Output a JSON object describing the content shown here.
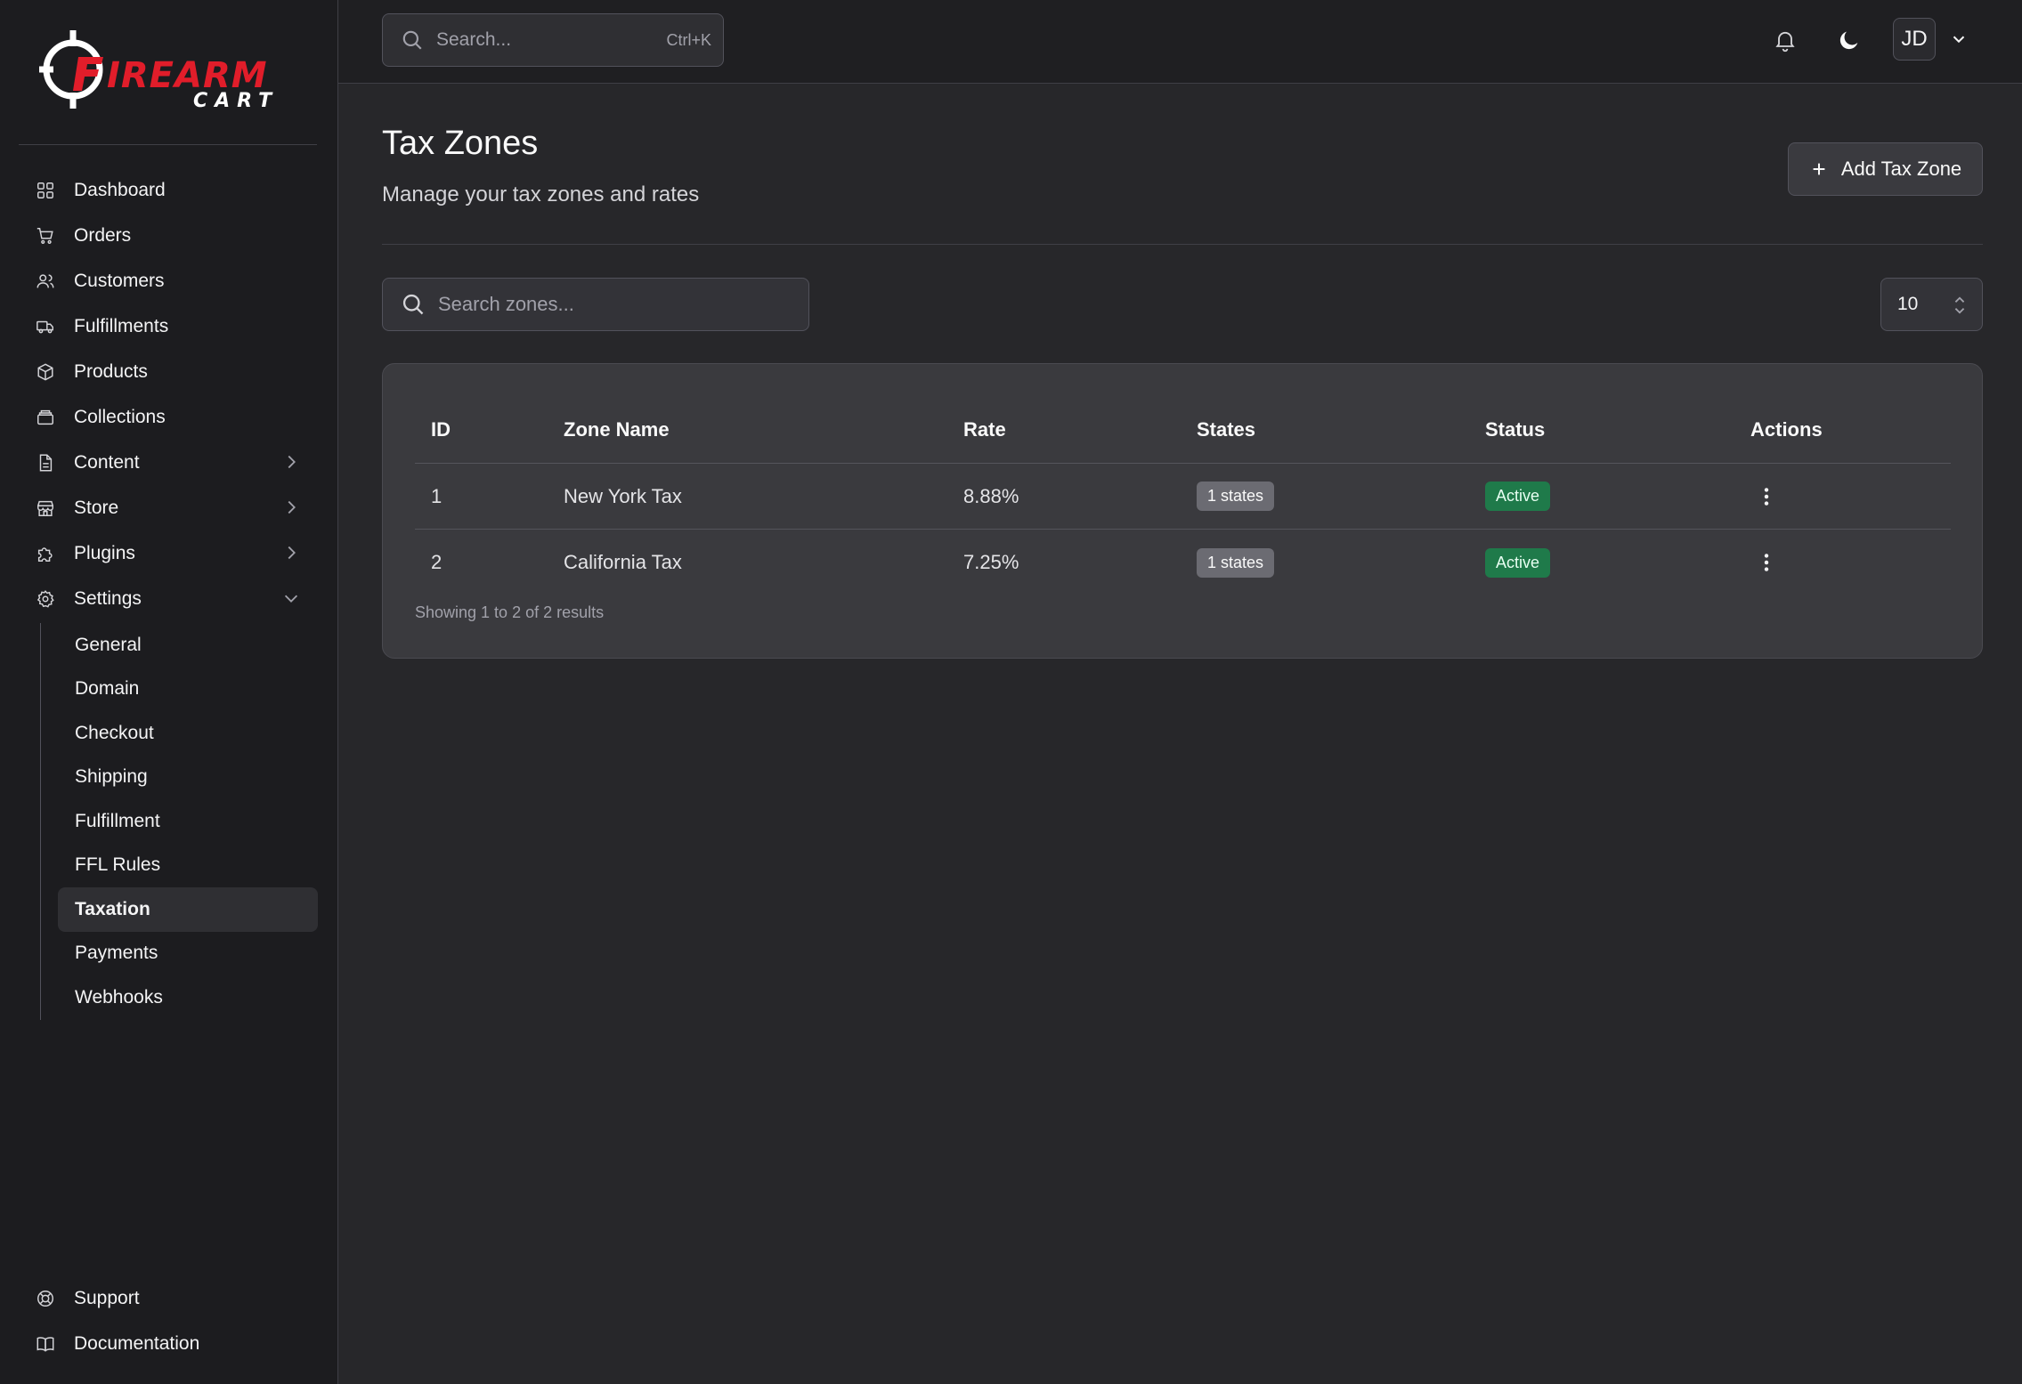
{
  "brand": {
    "logo_line1": "FIREARM",
    "logo_line2": "CART",
    "accent_color": "#e11d2a"
  },
  "sidebar": {
    "items": [
      {
        "label": "Dashboard",
        "icon": "dashboard-icon"
      },
      {
        "label": "Orders",
        "icon": "cart-icon"
      },
      {
        "label": "Customers",
        "icon": "users-icon"
      },
      {
        "label": "Fulfillments",
        "icon": "truck-icon"
      },
      {
        "label": "Products",
        "icon": "box-icon"
      },
      {
        "label": "Collections",
        "icon": "archive-icon"
      },
      {
        "label": "Content",
        "icon": "file-icon",
        "expandable": true
      },
      {
        "label": "Store",
        "icon": "store-icon",
        "expandable": true
      },
      {
        "label": "Plugins",
        "icon": "puzzle-icon",
        "expandable": true
      },
      {
        "label": "Settings",
        "icon": "gear-icon",
        "expanded": true
      }
    ],
    "settings_subitems": [
      {
        "label": "General"
      },
      {
        "label": "Domain"
      },
      {
        "label": "Checkout"
      },
      {
        "label": "Shipping"
      },
      {
        "label": "Fulfillment"
      },
      {
        "label": "FFL Rules"
      },
      {
        "label": "Taxation",
        "active": true
      },
      {
        "label": "Payments"
      },
      {
        "label": "Webhooks"
      }
    ],
    "bottom_items": [
      {
        "label": "Support",
        "icon": "lifebuoy-icon"
      },
      {
        "label": "Documentation",
        "icon": "book-icon"
      }
    ]
  },
  "topbar": {
    "search_placeholder": "Search...",
    "search_shortcut": "Ctrl+K",
    "avatar_initials": "JD"
  },
  "page": {
    "title": "Tax Zones",
    "subtitle": "Manage your tax zones and rates",
    "add_button_label": "Add Tax Zone",
    "zone_search_placeholder": "Search zones...",
    "per_page": "10"
  },
  "table": {
    "headers": {
      "id": "ID",
      "zone_name": "Zone Name",
      "rate": "Rate",
      "states": "States",
      "status": "Status",
      "actions": "Actions"
    },
    "rows": [
      {
        "id": "1",
        "zone_name": "New York Tax",
        "rate": "8.88%",
        "states": "1 states",
        "status": "Active"
      },
      {
        "id": "2",
        "zone_name": "California Tax",
        "rate": "7.25%",
        "states": "1 states",
        "status": "Active"
      }
    ],
    "footer": "Showing 1 to 2 of 2 results"
  },
  "colors": {
    "background": "#27272a",
    "sidebar": "#1c1c1f",
    "card": "#3a3a3e",
    "status_active": "#1f7a4a"
  }
}
